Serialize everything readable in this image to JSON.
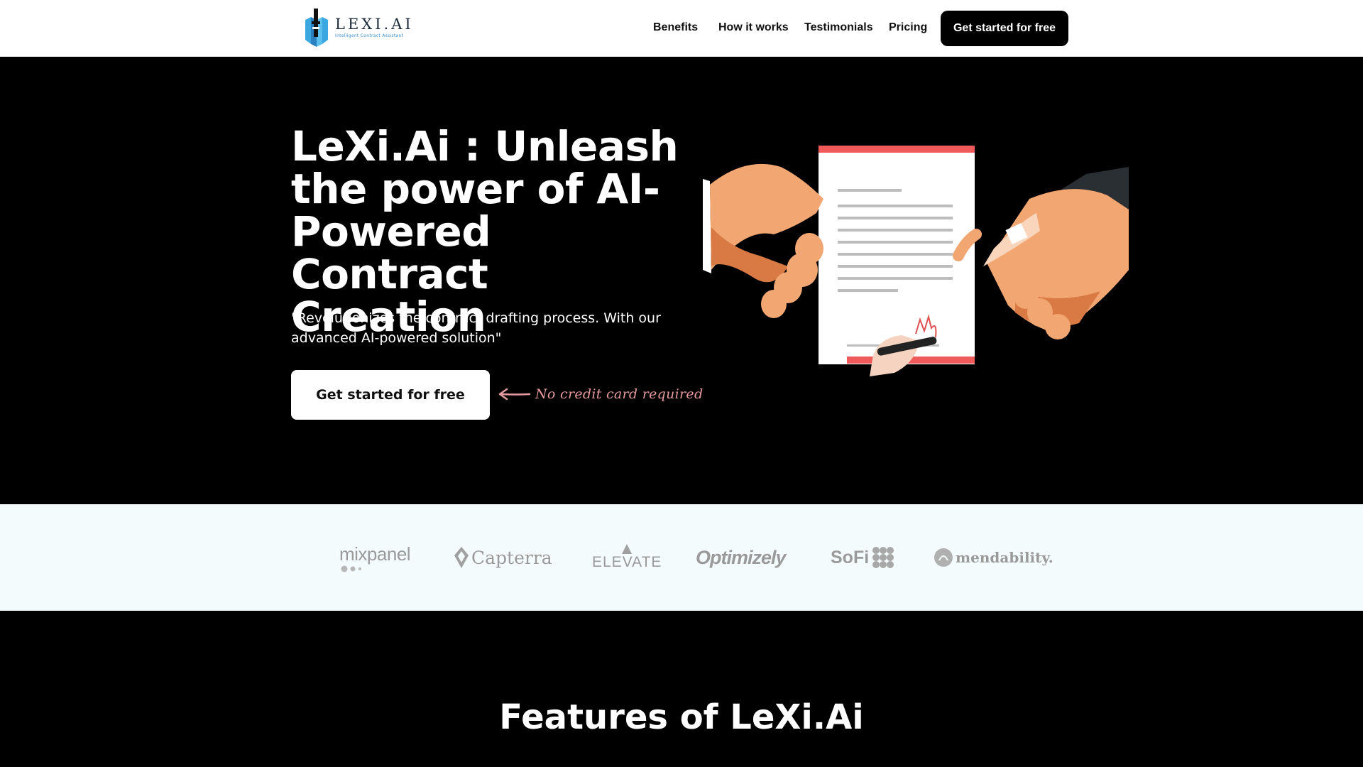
{
  "header": {
    "logo_name": "LEXI.AI",
    "logo_tagline": "Intelligent Contract Assistant",
    "nav": [
      "Benefits",
      "How it works",
      "Testimonials",
      "Pricing"
    ],
    "cta_label": "Get started for free"
  },
  "hero": {
    "title": "LeXi.Ai : Unleash the power of AI-Powered Contract Creation",
    "subtitle": " \"Revolutionizes the contract drafting process. With our advanced AI-powered solution\"",
    "cta_label": "Get started for free",
    "note": "No credit card required"
  },
  "logos": [
    "mixpanel",
    "Capterra",
    "ELEVATE",
    "Optimizely",
    "SoFi",
    "mendability."
  ],
  "features": {
    "title": "Features of LeXi.Ai"
  },
  "colors": {
    "background": "#000000",
    "header_bg": "#ffffff",
    "logo_strip_bg": "#f4fbfc",
    "note_pink": "#e59aa0",
    "logo_blue": "#3aa7e0"
  }
}
